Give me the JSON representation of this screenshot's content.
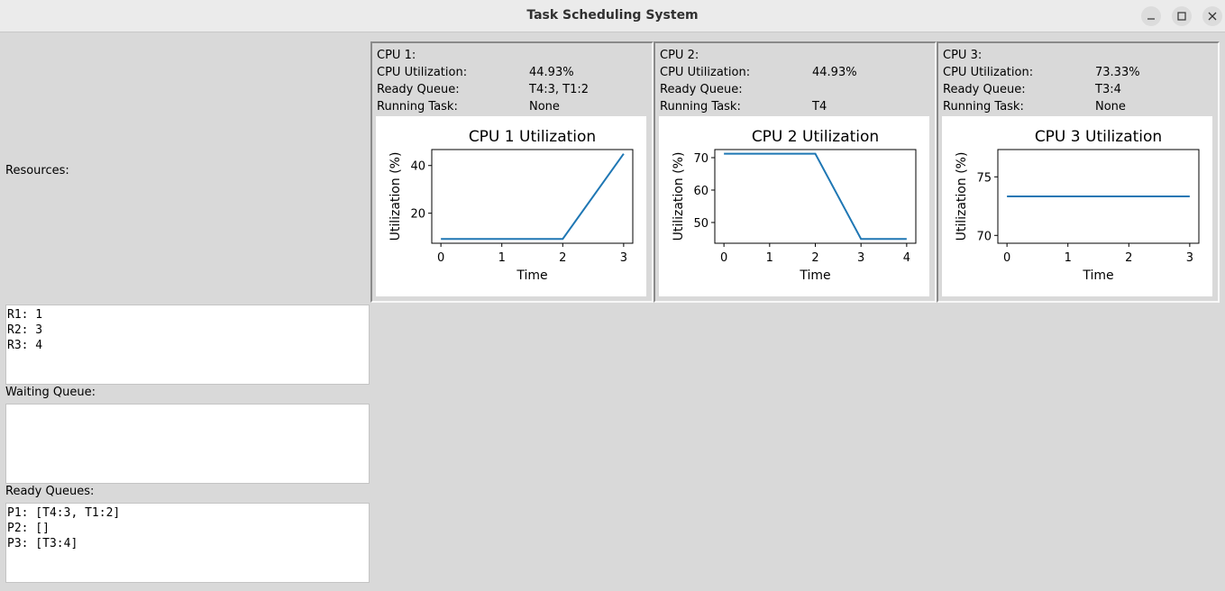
{
  "window": {
    "title": "Task Scheduling System",
    "controls": [
      "minimize-icon",
      "maximize-icon",
      "close-icon"
    ]
  },
  "resources": {
    "label": "Resources:",
    "lines": [
      "R1: 1",
      "R2: 3",
      "R3: 4"
    ]
  },
  "waiting_queue": {
    "label": "Waiting Queue:",
    "lines": []
  },
  "ready_queues": {
    "label": "Ready Queues:",
    "lines": [
      "P1: [T4:3, T1:2]",
      "P2: []",
      "P3: [T3:4]"
    ]
  },
  "cpus": [
    {
      "header": "CPU 1:",
      "util_label": "CPU Utilization:",
      "util_value": "44.93%",
      "ready_label": "Ready Queue:",
      "ready_value": "T4:3, T1:2",
      "running_label": "Running Task:",
      "running_value": "None"
    },
    {
      "header": "CPU 2:",
      "util_label": "CPU Utilization:",
      "util_value": "44.93%",
      "ready_label": "Ready Queue:",
      "ready_value": "",
      "running_label": "Running Task:",
      "running_value": "T4"
    },
    {
      "header": "CPU 3:",
      "util_label": "CPU Utilization:",
      "util_value": "73.33%",
      "ready_label": "Ready Queue:",
      "ready_value": "T3:4",
      "running_label": "Running Task:",
      "running_value": "None"
    }
  ],
  "chart_data": [
    {
      "type": "line",
      "title": "CPU 1 Utilization",
      "xlabel": "Time",
      "ylabel": "Utilization (%)",
      "x": [
        0,
        1,
        2,
        3
      ],
      "series": [
        {
          "values": [
            9.2,
            9.2,
            9.2,
            44.93
          ]
        }
      ],
      "xlim": [
        -0.15,
        3.15
      ],
      "ylim": [
        7.4,
        46.7
      ],
      "xticks": [
        0,
        1,
        2,
        3
      ],
      "yticks": [
        20,
        40
      ],
      "color": "#1f77b4"
    },
    {
      "type": "line",
      "title": "CPU 2 Utilization",
      "xlabel": "Time",
      "ylabel": "Utilization (%)",
      "x": [
        0,
        1,
        2,
        3,
        4
      ],
      "series": [
        {
          "values": [
            71.2,
            71.2,
            71.2,
            44.93,
            44.93
          ]
        }
      ],
      "xlim": [
        -0.2,
        4.2
      ],
      "ylim": [
        43.6,
        72.5
      ],
      "xticks": [
        0,
        1,
        2,
        3,
        4
      ],
      "yticks": [
        50,
        60,
        70
      ],
      "color": "#1f77b4"
    },
    {
      "type": "line",
      "title": "CPU 3 Utilization",
      "xlabel": "Time",
      "ylabel": "Utilization (%)",
      "x": [
        0,
        1,
        2,
        3
      ],
      "series": [
        {
          "values": [
            73.33,
            73.33,
            73.33,
            73.33
          ]
        }
      ],
      "xlim": [
        -0.15,
        3.15
      ],
      "ylim": [
        69.33,
        77.33
      ],
      "xticks": [
        0,
        1,
        2,
        3
      ],
      "yticks": [
        70,
        75
      ],
      "color": "#1f77b4"
    }
  ]
}
